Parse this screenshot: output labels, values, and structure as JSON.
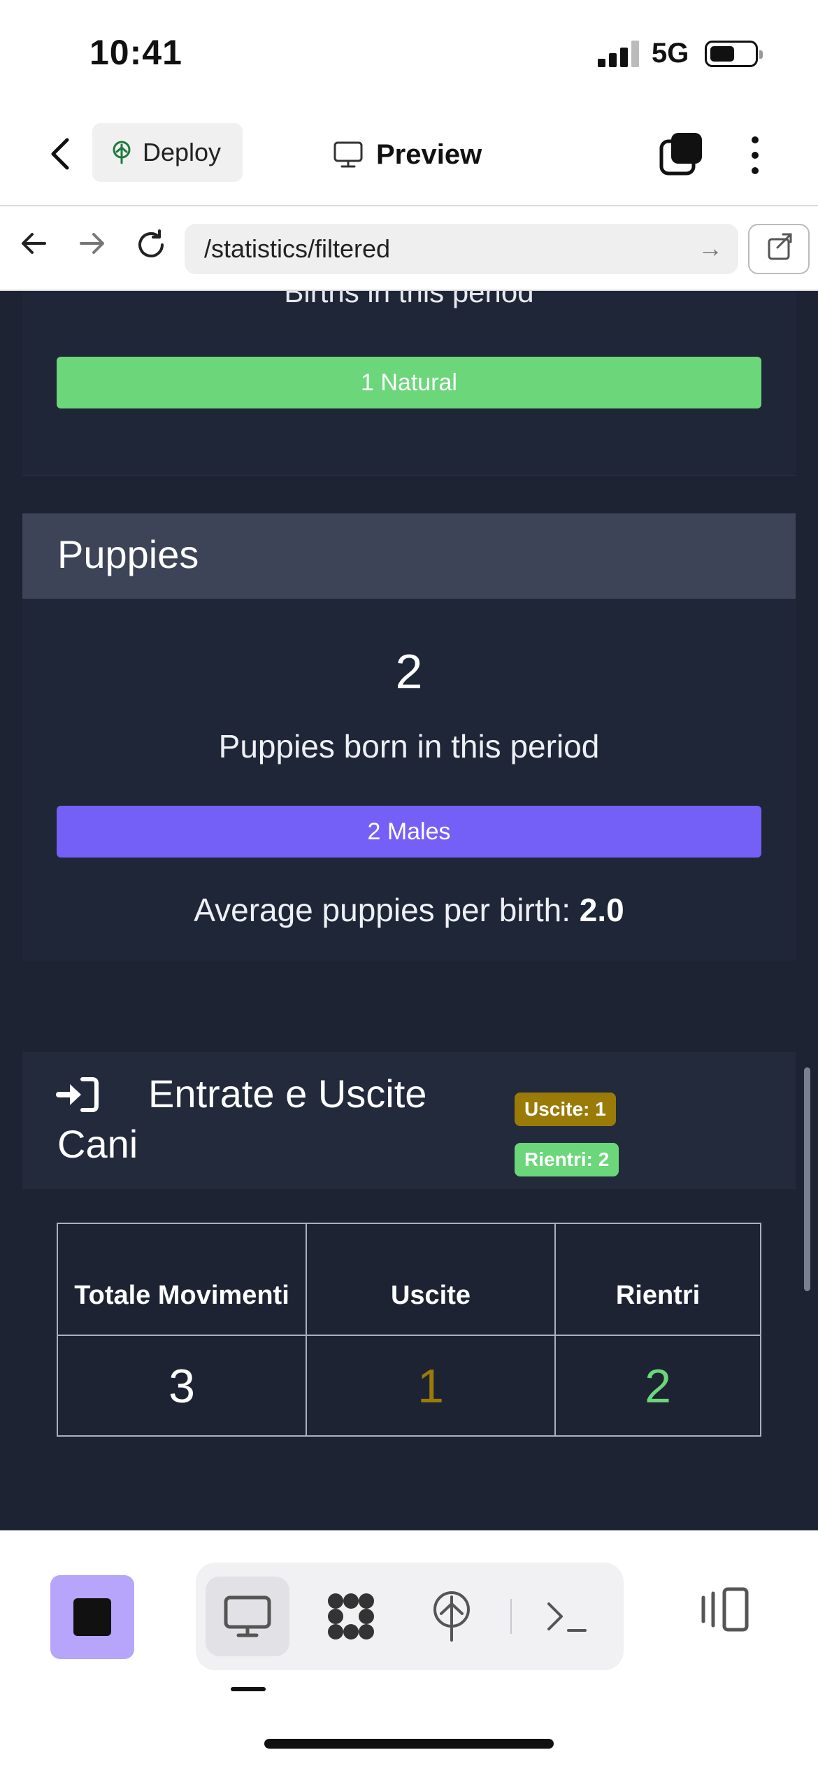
{
  "status": {
    "time": "10:41",
    "network": "5G"
  },
  "header": {
    "deploy_label": "Deploy",
    "preview_label": "Preview"
  },
  "urlbar": {
    "path": "/statistics/filtered"
  },
  "births": {
    "label": "Births in this period",
    "bar_label": "1 Natural"
  },
  "puppies": {
    "title": "Puppies",
    "count": "2",
    "count_label": "Puppies born in this period",
    "bar_label": "2 Males",
    "avg_label": "Average puppies per birth:",
    "avg_value": "2.0"
  },
  "movements": {
    "title": "Entrate e Uscite Cani",
    "badge_out": "Uscite: 1",
    "badge_in": "Rientri: 2",
    "table": {
      "headers": [
        "Totale Movimenti",
        "Uscite",
        "Rientri"
      ],
      "values": [
        "3",
        "1",
        "2"
      ]
    }
  },
  "colors": {
    "background": "#1d2333",
    "natural_bar": "#6bd67a",
    "males_bar": "#7460f7",
    "uscite": "#9a7b08",
    "rientri": "#6bd67a",
    "stop_button": "#b6a5fb"
  }
}
